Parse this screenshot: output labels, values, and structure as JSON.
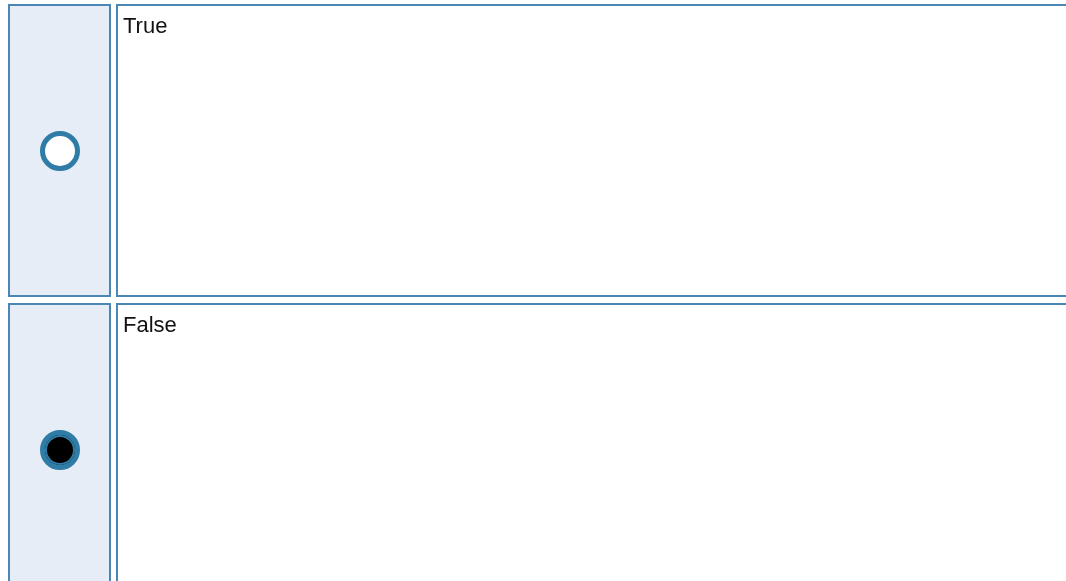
{
  "options": [
    {
      "label": "True",
      "selected": false
    },
    {
      "label": "False",
      "selected": true
    }
  ]
}
